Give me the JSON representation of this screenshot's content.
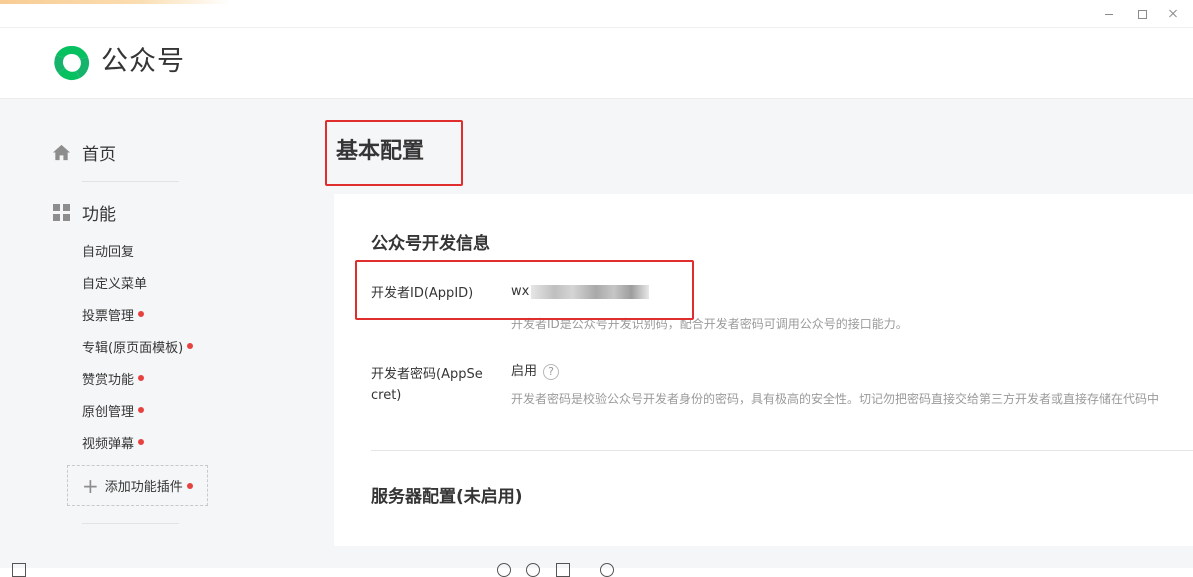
{
  "header": {
    "logo_text": "公众号"
  },
  "sidebar": {
    "home_label": "首页",
    "func_label": "功能",
    "items": [
      {
        "label": "自动回复",
        "dot": false
      },
      {
        "label": "自定义菜单",
        "dot": false
      },
      {
        "label": "投票管理",
        "dot": true
      },
      {
        "label": "专辑(原页面模板)",
        "dot": true
      },
      {
        "label": "赞赏功能",
        "dot": true
      },
      {
        "label": "原创管理",
        "dot": true
      },
      {
        "label": "视频弹幕",
        "dot": true
      }
    ],
    "add_plugin_label": "添加功能插件",
    "add_plugin_dot": true
  },
  "main": {
    "page_title": "基本配置",
    "dev_info": {
      "title": "公众号开发信息",
      "appid_label": "开发者ID(AppID)",
      "appid_value_prefix": "wx",
      "appid_desc": "开发者ID是公众号开发识别码，配合开发者密码可调用公众号的接口能力。",
      "secret_label_line1": "开发者密码(AppSe",
      "secret_label_line2": "cret)",
      "secret_status": "启用",
      "secret_help": "?",
      "secret_desc": "开发者密码是校验公众号开发者身份的密码，具有极高的安全性。切记勿把密码直接交给第三方开发者或直接存储在代码中"
    },
    "server_config": {
      "title": "服务器配置(未启用)"
    }
  },
  "colors": {
    "brand_green": "#07c160",
    "highlight_red": "#e02d2d",
    "notice_dot": "#e64340"
  }
}
